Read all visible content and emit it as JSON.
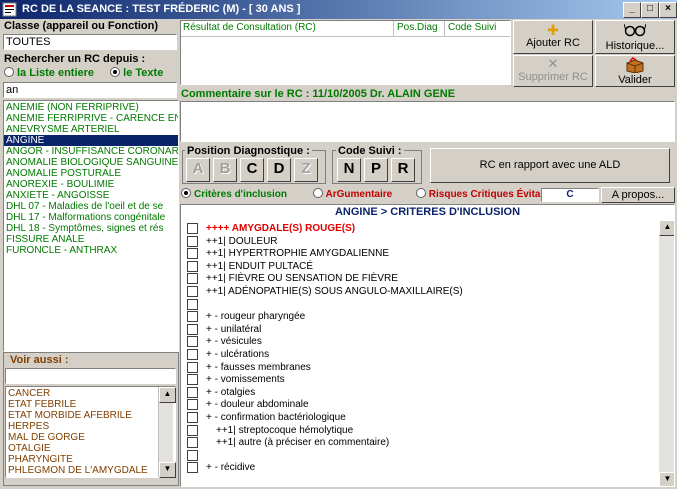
{
  "window": {
    "title": "RC DE LA SEANCE : TEST FRÉDERIC (M) - [ 30 ANS ]",
    "minimize": "_",
    "maximize": "□",
    "close": "×"
  },
  "left": {
    "class_label": "Classe (appareil ou Fonction)",
    "class_value": "TOUTES",
    "search_label": "Rechercher un RC depuis :",
    "radio_list": "la Liste entiere",
    "radio_text": "le Texte",
    "search_value": "an",
    "items": [
      "ANEMIE (NON FERRIPRIVE)",
      "ANEMIE FERRIPRIVE - CARENCE EN",
      "ANEVRYSME ARTERIEL",
      "ANGINE",
      "ANGOR - INSUFFISANCE CORONAR",
      "ANOMALIE BIOLOGIQUE SANGUINE",
      "ANOMALIE POSTURALE",
      "ANOREXIE - BOULIMIE",
      "ANXIETE - ANGOISSE",
      "DHL 07 - Maladies de l'oeil et de se",
      "DHL 17 - Malformations congénitale",
      "DHL 18 - Symptômes, signes et rés",
      "FISSURE ANALE",
      "FURONCLE - ANTHRAX"
    ],
    "see_also_label": "Voir aussi :",
    "see_also_input": "",
    "see_also_items": [
      "CANCER",
      "ETAT FEBRILE",
      "ETAT MORBIDE AFEBRILE",
      "HERPES",
      "MAL DE GORGE",
      "OTALGIE",
      "PHARYNGITE",
      "PHLEGMON DE L'AMYGDALE"
    ]
  },
  "rc_table": {
    "col_result": "Résultat de Consultation (RC)",
    "col_pos": "Pos.Diag",
    "col_code": "Code Suivi"
  },
  "buttons": {
    "add": "Ajouter  RC",
    "history": "Historique...",
    "delete": "Supprimer RC",
    "validate": "Valider",
    "ald": "RC en rapport avec une ALD",
    "about": "A propos..."
  },
  "comment": {
    "label": "Commentaire sur le RC :   11/10/2005 Dr. ALAIN GENE",
    "value": ""
  },
  "pos_diag": {
    "label": "Position Diagnostique :",
    "letters": [
      "A",
      "B",
      "C",
      "D",
      "Z"
    ]
  },
  "code_suivi": {
    "label": "Code Suivi :",
    "letters": [
      "N",
      "P",
      "R"
    ]
  },
  "tabs": {
    "inclusion": "Critères d'inclusion",
    "argumentaire": "ArGumentaire",
    "risques": "Risques Critiques Évitables",
    "code": "C"
  },
  "criteria": {
    "header": "ANGINE > CRITERES D'INCLUSION",
    "rows": [
      "++++ AMYGDALE(S) ROUGE(S)",
      "++1| DOULEUR",
      "++1| HYPERTROPHIE AMYGDALIENNE",
      "++1| ENDUIT PULTACÉ",
      "++1| FIÈVRE OU SENSATION DE FIÈVRE",
      "++1| ADÉNOPATHIE(S) SOUS ANGULO-MAXILLAIRE(S)",
      "",
      "+ - rougeur pharyngée",
      "+ - unilatéral",
      "+ - vésicules",
      "+ - ulcérations",
      "+ - fausses membranes",
      "+ - vomissements",
      "+ - otalgies",
      "+ - douleur abdominale",
      "+ - confirmation bactériologique",
      "++1| streptocoque hémolytique",
      "++1| autre (à préciser en commentaire)",
      "",
      "+ - récidive"
    ]
  },
  "colors": {
    "accent": "#0a246a",
    "green": "#007a00",
    "red": "#e00000",
    "maroon": "#804000"
  }
}
